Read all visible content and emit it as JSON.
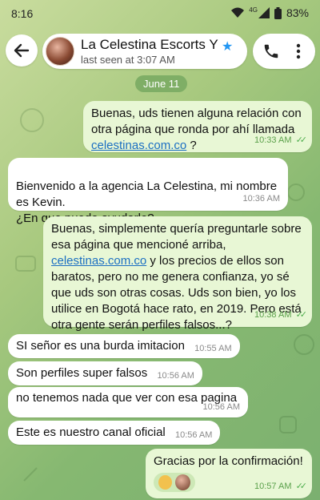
{
  "status_bar": {
    "time": "8:16",
    "network": "4G",
    "battery": "83%"
  },
  "header": {
    "contact_name": "La Celestina Escorts Y P",
    "last_seen": "last seen at 3:07 AM",
    "icons": [
      "back-arrow-icon",
      "verified-star-icon",
      "phone-icon",
      "more-vert-icon"
    ]
  },
  "date_chip": "June 11",
  "messages": [
    {
      "direction": "out",
      "text_before": "Buenas, uds tienen alguna relación con otra página que ronda por ahí llamada ",
      "link": "celestinas.com.co",
      "text_after": " ?",
      "time": "10:33 AM",
      "ticks": "✓✓"
    },
    {
      "direction": "in",
      "text": "Bienvenido a la agencia La Celestina, mi nombre es Kevin.\n¿En que puedo ayudarle?.",
      "time": "10:36 AM"
    },
    {
      "direction": "out",
      "text_before": "Buenas, simplemente quería preguntarle sobre esa página que mencioné arriba, ",
      "link": "celestinas.com.co",
      "text_after": " y los precios de ellos son baratos, pero no me genera confianza, yo sé que uds son otras cosas. Uds son bien, yo los utilice en Bogotá hace rato, en 2019. Pero está otra gente serán perfiles falsos...?",
      "time": "10:38 AM",
      "ticks": "✓✓"
    },
    {
      "direction": "in",
      "text": "SI señor es una burda imitacion",
      "time": "10:55 AM"
    },
    {
      "direction": "in",
      "text": "Son perfiles super falsos",
      "time": "10:56 AM"
    },
    {
      "direction": "in",
      "text": "no tenemos nada que ver con esa pagina",
      "time": "10:56 AM"
    },
    {
      "direction": "in",
      "text": "Este es nuestro canal oficial",
      "time": "10:56 AM"
    },
    {
      "direction": "out",
      "text": "Gracias por la confirmación!",
      "time": "10:57 AM",
      "ticks": "✓✓",
      "reaction": "thumbs-up-reaction"
    }
  ],
  "colors": {
    "outgoing_bubble": "#e8f7d5",
    "incoming_bubble": "#ffffff",
    "link": "#1b6fc2",
    "read_ticks": "#4fae4e",
    "verified": "#2196f3",
    "date_chip": "#7fae66"
  }
}
